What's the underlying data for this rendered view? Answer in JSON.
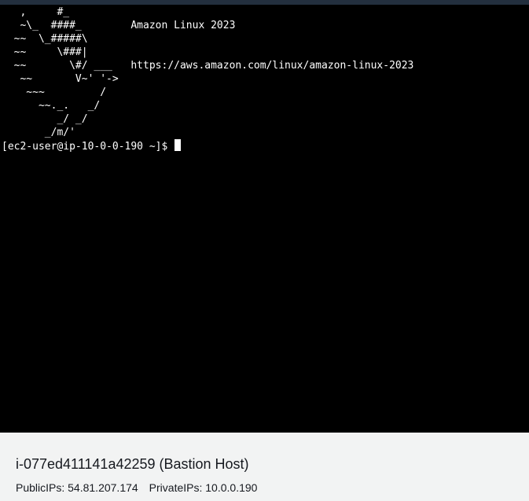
{
  "terminal": {
    "motd": [
      "   ,     #_",
      "   ~\\_  ####_        Amazon Linux 2023",
      "  ~~  \\_#####\\",
      "  ~~     \\###|",
      "  ~~       \\#/ ___   https://aws.amazon.com/linux/amazon-linux-2023",
      "   ~~       V~' '->",
      "    ~~~         /",
      "      ~~._.   _/",
      "         _/ _/",
      "       _/m/'"
    ],
    "prompt": "[ec2-user@ip-10-0-0-190 ~]$ "
  },
  "instance": {
    "id_and_name": "i-077ed411141a42259 (Bastion Host)",
    "public_ips_label": "PublicIPs:",
    "public_ips_value": "54.81.207.174",
    "private_ips_label": "PrivateIPs:",
    "private_ips_value": "10.0.0.190"
  },
  "colors": {
    "terminal_bg": "#000000",
    "terminal_fg": "#ffffff",
    "panel_bg": "#f2f3f3"
  }
}
